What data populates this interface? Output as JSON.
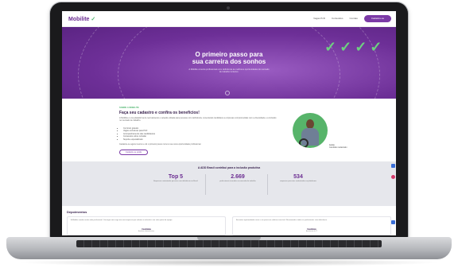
{
  "site": {
    "logo": "Mobilite",
    "logo_mark": "✓",
    "nav": [
      "Vagas PcD",
      "Conteúdos",
      "Contato"
    ],
    "nav_cta": "Cadastre-se"
  },
  "hero": {
    "title_line1": "O primeiro passo para",
    "title_line2": "sua carreira dos sonhos",
    "subtitle": "A Mobilite conecta profissionais com deficiência às melhores oportunidades do mercado de trabalho inclusivo.",
    "check_icons": [
      "check-icon",
      "check-icon",
      "check-icon",
      "check-icon"
    ],
    "check_color": "#6ed081"
  },
  "about": {
    "eyebrow": "SOBRE A MOBILITE",
    "title": "Faça seu cadastro e confira os benefícios!",
    "paragraph": "A Mobilite é uma plataforma de recrutamento e seleção voltada para pessoas com deficiência, conectando candidatos a empresas comprometidas com a diversidade e a inclusão no mercado de trabalho.",
    "bullets": [
      "Currículo gratuito",
      "Vagas exclusivas para PcD",
      "Acompanhamento das candidaturas",
      "Conteúdos sobre inclusão",
      "Suporte especializado"
    ],
    "paragraph2": "Cadastre-se agora mesmo e dê o primeiro passo rumo à sua nova oportunidade profissional.",
    "button": "Cadastre-se grátis",
    "caption_name": "Lucas",
    "caption_role": "Candidato cadastrado"
  },
  "stats": {
    "title": "A ADD Brasil contribui para a inclusão produtiva",
    "items": [
      {
        "value": "Top 5",
        "label": "Empresas contratando pessoas com deficiência no Brasil"
      },
      {
        "value": "2.669",
        "label": "profissionais inseridos no mercado de trabalho"
      },
      {
        "value": "534",
        "label": "empresas parceiras cadastradas na plataforma"
      }
    ]
  },
  "testimonials": {
    "title": "Depoimentos",
    "cards": [
      {
        "text": "A Mobilite mudou minha vida profissional. Consegui uma vaga em uma empresa que valoriza a inclusão e me sinto parte da equipe.",
        "name": "Candidata",
        "role": "Analista administrativa"
      },
      {
        "text": "Encontrei oportunidades reais e um processo seletivo acessível. Recomendo a todos os profissionais com deficiência.",
        "name": "Candidato",
        "role": "Assistente de TI"
      }
    ]
  },
  "colors": {
    "brand_purple": "#6b2c91",
    "brand_green": "#4fb56f",
    "stats_bg": "#e6e7ec"
  }
}
